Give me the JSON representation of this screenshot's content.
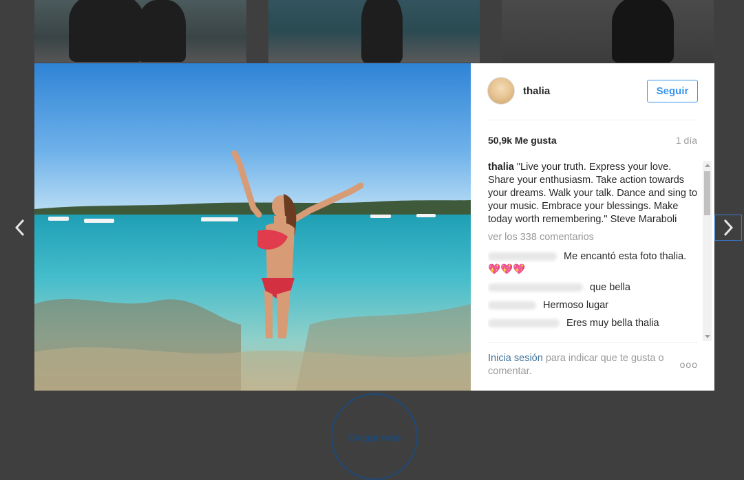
{
  "post": {
    "username": "thalia",
    "follow_label": "Seguir",
    "likes": "50,9k Me gusta",
    "time": "1 día",
    "caption_user": "thalia",
    "caption_text": "\"Live your truth. Express your love. Share your enthusiasm. Take action towards your dreams. Walk your talk. Dance and sing to your music. Embrace your blessings. Make today worth remembering.\" Steve Maraboli",
    "view_all": "ver los 338 comentarios",
    "comments": [
      {
        "text": "Me encantó esta foto thalia.💖💖💖"
      },
      {
        "text": "que bella"
      },
      {
        "text": "Hermoso lugar"
      },
      {
        "text": "Eres muy bella thalia"
      }
    ]
  },
  "footer": {
    "login_link": "Inicia sesión",
    "login_rest": " para indicar que te gusta o comentar.",
    "more_label": "ooo"
  },
  "page": {
    "load_more": "Cargar más"
  },
  "icons": {
    "prev": "chevron-left-icon",
    "next": "chevron-right-icon"
  },
  "colors": {
    "accent": "#3897f0",
    "link": "#3f729b",
    "backdrop": "#3f3f3f"
  }
}
